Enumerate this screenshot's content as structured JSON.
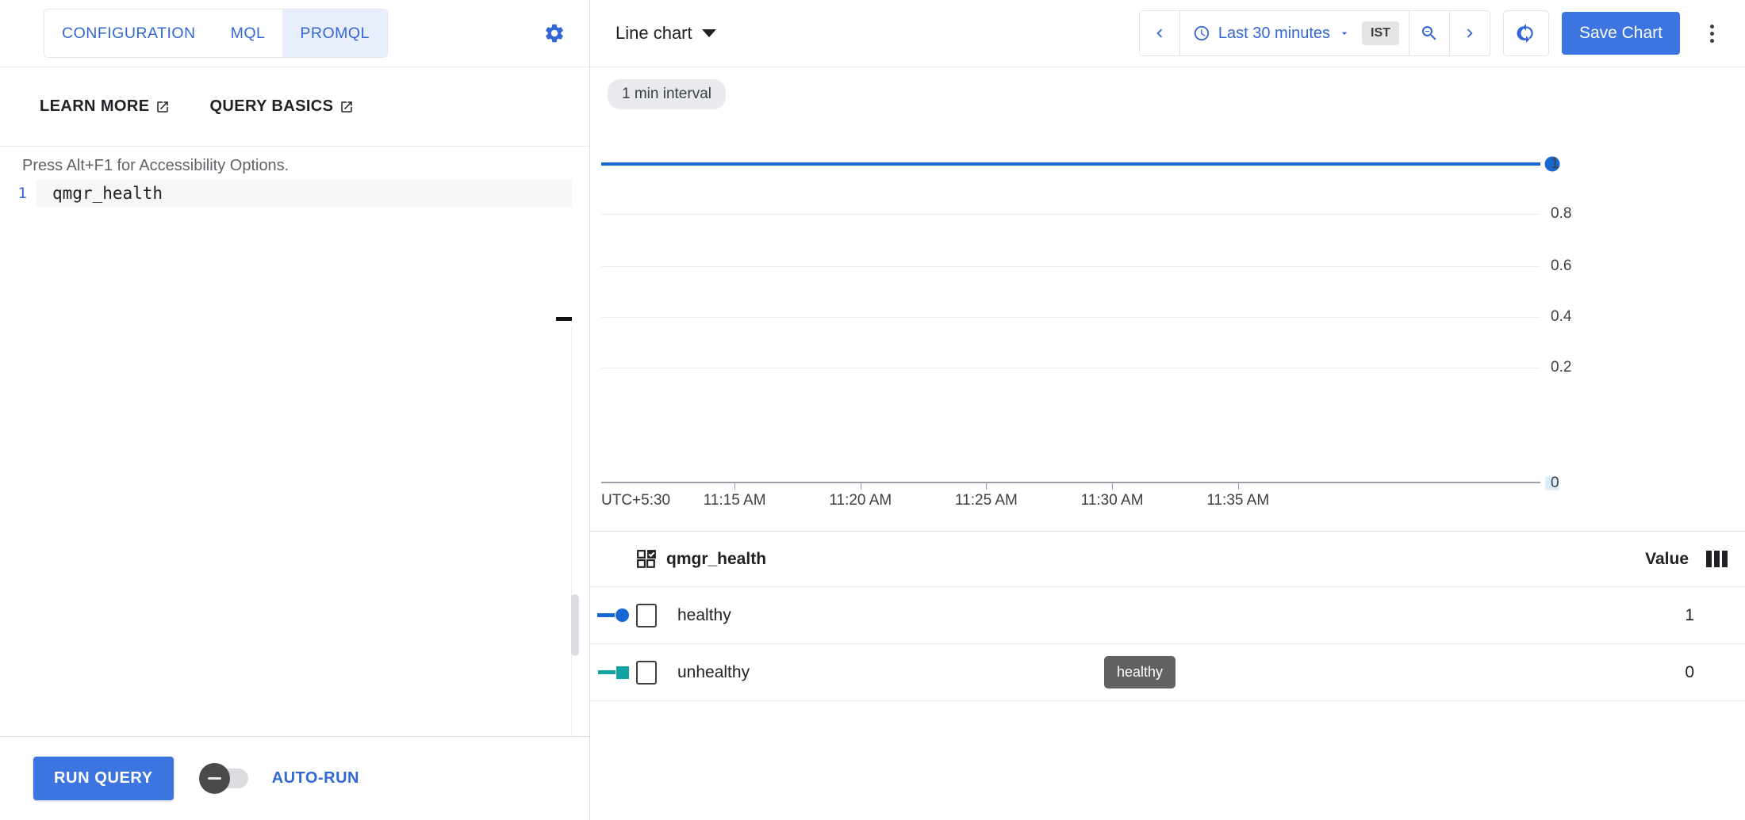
{
  "left": {
    "tabs": [
      {
        "label": "CONFIGURATION",
        "active": false
      },
      {
        "label": "MQL",
        "active": false
      },
      {
        "label": "PROMQL",
        "active": true
      }
    ],
    "settings_icon": "gear-icon",
    "links": [
      {
        "label": "LEARN MORE",
        "icon": "open-in-new-icon"
      },
      {
        "label": "QUERY BASICS",
        "icon": "open-in-new-icon"
      }
    ],
    "editor": {
      "a11y_hint": "Press Alt+F1 for Accessibility Options.",
      "line_number": "1",
      "code": "qmgr_health"
    },
    "footer": {
      "run_query_label": "RUN QUERY",
      "autorun_label": "AUTO-RUN",
      "autorun_on": false
    }
  },
  "right": {
    "toolbar": {
      "chart_type": "Line chart",
      "prev_icon": "chevron-left-icon",
      "clock_icon": "clock-icon",
      "time_range": "Last 30 minutes",
      "range_caret": "chevron-down-icon",
      "timezone": "IST",
      "zoom_out_icon": "zoom-out-icon",
      "next_icon": "chevron-right-icon",
      "refresh_icon": "refresh-icon",
      "save_label": "Save Chart",
      "more_icon": "more-vert-icon"
    },
    "chart": {
      "interval_chip": "1 min interval"
    },
    "legend": {
      "metric_icon": "select-all-check-icon",
      "metric_name": "qmgr_health",
      "value_header": "Value",
      "columns_icon": "columns-icon",
      "rows": [
        {
          "label": "healthy",
          "value": "1",
          "color": "#1967d2",
          "marker": "circle",
          "checked": false
        },
        {
          "label": "unhealthy",
          "value": "0",
          "color": "#12a4a4",
          "marker": "square",
          "checked": false
        }
      ]
    },
    "tooltip": {
      "text": "healthy"
    }
  },
  "colors": {
    "accent_blue": "#3c74e0",
    "link_blue": "#3367d6",
    "series_healthy": "#1967d2",
    "series_unhealthy": "#12a4a4",
    "tab_active_bg": "#e8eefc",
    "chip_bg": "#e8eaed"
  },
  "chart_data": {
    "type": "line",
    "title": "qmgr_health",
    "xlabel": "",
    "ylabel": "",
    "timezone_label": "UTC+5:30",
    "interval": "1 min interval",
    "grid": true,
    "legend_position": "bottom-table",
    "ylim": [
      0,
      1
    ],
    "yticks": [
      "0",
      "0.2",
      "0.4",
      "0.6",
      "0.8",
      "1"
    ],
    "xticks": [
      "11:15 AM",
      "11:20 AM",
      "11:25 AM",
      "11:30 AM",
      "11:35 AM"
    ],
    "xtick_fractions": [
      0.142,
      0.276,
      0.41,
      0.544,
      0.678
    ],
    "series": [
      {
        "name": "healthy",
        "color": "#1967d2",
        "marker": "circle",
        "constant_value": 1,
        "last_value": 1,
        "values": [
          1,
          1,
          1,
          1,
          1,
          1,
          1,
          1,
          1,
          1,
          1,
          1,
          1,
          1,
          1,
          1,
          1,
          1,
          1,
          1,
          1,
          1,
          1,
          1,
          1,
          1,
          1,
          1,
          1,
          1
        ]
      },
      {
        "name": "unhealthy",
        "color": "#12a4a4",
        "marker": "square",
        "constant_value": 0,
        "last_value": 0,
        "values": [
          0,
          0,
          0,
          0,
          0,
          0,
          0,
          0,
          0,
          0,
          0,
          0,
          0,
          0,
          0,
          0,
          0,
          0,
          0,
          0,
          0,
          0,
          0,
          0,
          0,
          0,
          0,
          0,
          0,
          0
        ]
      }
    ]
  }
}
